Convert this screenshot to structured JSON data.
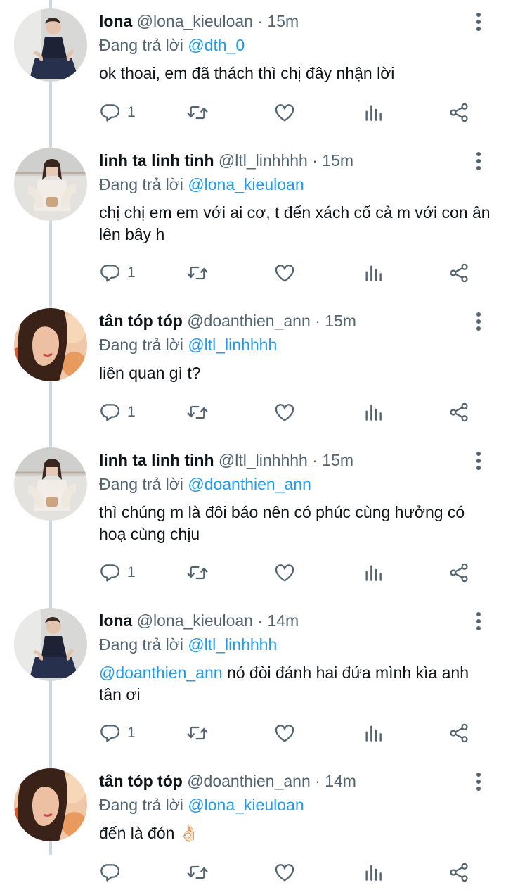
{
  "replying_prefix": "Đang trả lời",
  "tweets": [
    {
      "name": "lona",
      "handle": "@lona_kieuloan",
      "dot": "·",
      "time": "15m",
      "reply_to": "@dth_0",
      "text": "ok thoai, em đã thách thì chị đây nhận lời",
      "reply_count": "1"
    },
    {
      "name": "linh ta linh tinh",
      "handle": "@ltl_linhhhh",
      "dot": "·",
      "time": "15m",
      "reply_to": "@lona_kieuloan",
      "text": "chị chị em em với ai cơ, t đến xách cổ cả m với con ân lên bây h",
      "reply_count": "1"
    },
    {
      "name": "tân tóp tóp",
      "handle": "@doanthien_ann",
      "dot": "·",
      "time": "15m",
      "reply_to": "@ltl_linhhhh",
      "text": "liên quan gì t?",
      "reply_count": "1"
    },
    {
      "name": "linh ta linh tinh",
      "handle": "@ltl_linhhhh",
      "dot": "·",
      "time": "15m",
      "reply_to": "@doanthien_ann",
      "text": "thì chúng m là đôi báo nên có phúc cùng hưởng có hoạ cùng chịu",
      "reply_count": "1"
    },
    {
      "name": "lona",
      "handle": "@lona_kieuloan",
      "dot": "·",
      "time": "14m",
      "reply_to": "@ltl_linhhhh",
      "text_mention": "@doanthien_ann",
      "text": " nó đòi đánh hai đứa mình kìa anh tân ơi",
      "reply_count": "1"
    },
    {
      "name": "tân tóp tóp",
      "handle": "@doanthien_ann",
      "dot": "·",
      "time": "14m",
      "reply_to": "@lona_kieuloan",
      "text": "đến là đón 👌🏻",
      "reply_count": ""
    }
  ],
  "colors": {
    "accent": "#1d9bf0",
    "secondary_text": "#536471",
    "thread_line": "#cfd9de"
  },
  "icons": [
    "reply-icon",
    "retweet-icon",
    "like-icon",
    "stats-icon",
    "share-icon",
    "more-icon"
  ]
}
